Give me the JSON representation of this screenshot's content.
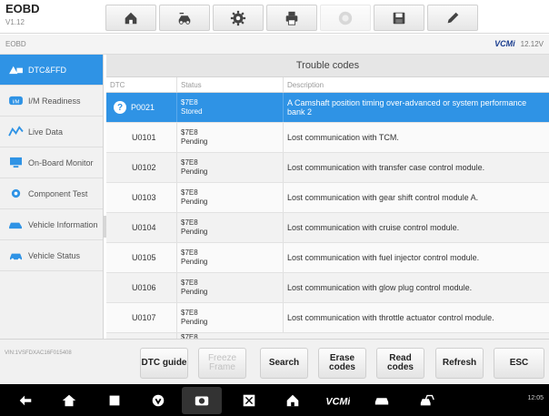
{
  "app": {
    "title": "EOBD",
    "version": "V1.12"
  },
  "toolbar": {
    "buttons": [
      {
        "name": "home-icon"
      },
      {
        "name": "vehicle-swap-icon"
      },
      {
        "name": "settings-icon"
      },
      {
        "name": "print-icon"
      },
      {
        "name": "help-icon",
        "disabled": true
      },
      {
        "name": "save-icon"
      },
      {
        "name": "edit-icon"
      }
    ]
  },
  "statusline": {
    "breadcrumb": "EOBD",
    "vci": "VCMi",
    "battery": "12.12V"
  },
  "sidebar": {
    "items": [
      {
        "label": "DTC&FFD",
        "icon": "dtc-icon",
        "active": true
      },
      {
        "label": "I/M Readiness",
        "icon": "readiness-icon"
      },
      {
        "label": "Live Data",
        "icon": "live-data-icon"
      },
      {
        "label": "On-Board Monitor",
        "icon": "monitor-icon"
      },
      {
        "label": "Component Test",
        "icon": "component-icon"
      },
      {
        "label": "Vehicle Information",
        "icon": "vehicle-info-icon"
      },
      {
        "label": "Vehicle Status",
        "icon": "vehicle-status-icon"
      }
    ]
  },
  "panel": {
    "title": "Trouble codes",
    "columns": {
      "dtc": "DTC",
      "status": "Status",
      "description": "Description"
    },
    "rows": [
      {
        "code": "P0021",
        "status": "$7E8\nStored",
        "description": "A Camshaft position timing over-advanced or system performance bank 2",
        "selected": true
      },
      {
        "code": "U0101",
        "status": "$7E8\nPending",
        "description": "Lost communication with TCM."
      },
      {
        "code": "U0102",
        "status": "$7E8\nPending",
        "description": "Lost communication with transfer case control module."
      },
      {
        "code": "U0103",
        "status": "$7E8\nPending",
        "description": "Lost communication with gear shift control module A."
      },
      {
        "code": "U0104",
        "status": "$7E8\nPending",
        "description": "Lost communication with cruise control module."
      },
      {
        "code": "U0105",
        "status": "$7E8\nPending",
        "description": "Lost communication with fuel injector control module."
      },
      {
        "code": "U0106",
        "status": "$7E8\nPending",
        "description": "Lost communication with glow plug control module."
      },
      {
        "code": "U0107",
        "status": "$7E8\nPending",
        "description": "Lost communication with throttle actuator control module."
      },
      {
        "code": "",
        "status": "$7E8",
        "description": ""
      }
    ]
  },
  "funcbar": {
    "vin": "VIN:1VSFDXAC16F015408",
    "buttons": [
      {
        "label": "DTC guide"
      },
      {
        "label": "Freeze Frame",
        "disabled": true
      },
      {
        "label": "Search"
      },
      {
        "label": "Erase codes"
      },
      {
        "label": "Read codes"
      },
      {
        "label": "Refresh"
      },
      {
        "label": "ESC"
      }
    ]
  },
  "navbar": {
    "tray": "12:05"
  },
  "colors": {
    "accent": "#2f93e5",
    "nav": "#000000"
  }
}
